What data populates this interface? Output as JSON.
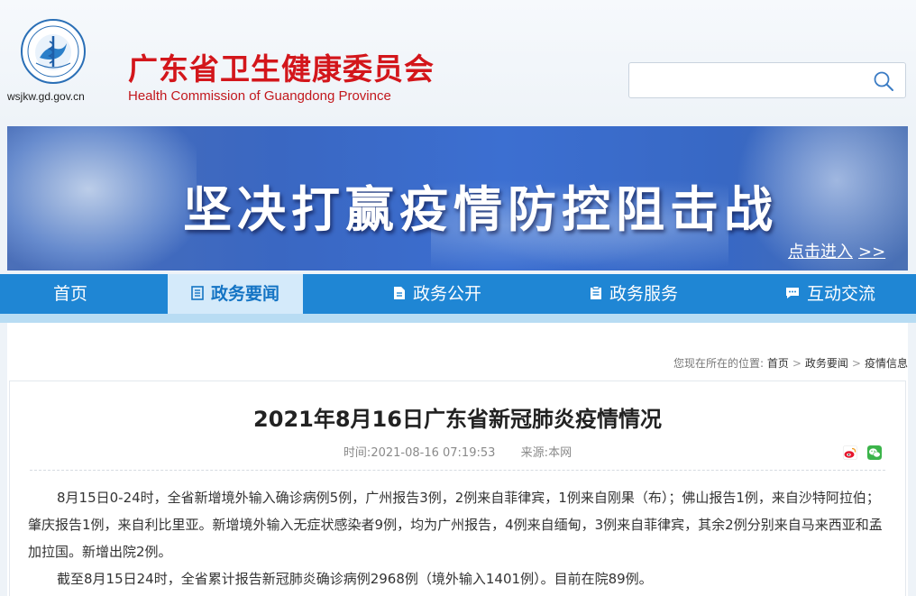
{
  "header": {
    "site_title": "广东省卫生健康委员会",
    "site_subtitle": "Health Commission of Guangdong Province",
    "domain": "wsjkw.gd.gov.cn",
    "logo_icon": "health-commission-emblem-icon",
    "search": {
      "placeholder": "",
      "value": "",
      "icon": "search-icon"
    }
  },
  "banner": {
    "slogan": "坚决打赢疫情防控阻击战",
    "enter_link": "点击进入",
    "enter_arrows": ">>"
  },
  "nav": {
    "items": [
      {
        "label": "首页",
        "icon": "",
        "active": false
      },
      {
        "label": "政务要闻",
        "icon": "news-icon",
        "active": true
      },
      {
        "label": "政务公开",
        "icon": "document-icon",
        "active": false
      },
      {
        "label": "政务服务",
        "icon": "clipboard-icon",
        "active": false
      },
      {
        "label": "互动交流",
        "icon": "chat-icon",
        "active": false
      }
    ],
    "colors": {
      "bar": "#1f86d4",
      "active_bg": "#d4eafa",
      "active_text": "#1474c4"
    }
  },
  "breadcrumb": {
    "prefix": "您现在所在的位置:",
    "items": [
      "首页",
      "政务要闻",
      "疫情信息"
    ],
    "separator": ">"
  },
  "article": {
    "title": "2021年8月16日广东省新冠肺炎疫情情况",
    "time_label": "时间:",
    "time": "2021-08-16 07:19:53",
    "source_label": "来源:",
    "source": "本网",
    "share_icons": [
      "weibo-icon",
      "wechat-icon"
    ],
    "paragraphs": [
      "8月15日0-24时，全省新增境外输入确诊病例5例，广州报告3例，2例来自菲律宾，1例来自刚果（布）；佛山报告1例，来自沙特阿拉伯；肇庆报告1例，来自利比里亚。新增境外输入无症状感染者9例，均为广州报告，4例来自缅甸，3例来自菲律宾，其余2例分别来自马来西亚和孟加拉国。新增出院2例。",
      "截至8月15日24时，全省累计报告新冠肺炎确诊病例2968例（境外输入1401例）。目前在院89例。"
    ]
  },
  "colors": {
    "title_red": "#d3161b",
    "page_bg": "#eef3f8"
  }
}
